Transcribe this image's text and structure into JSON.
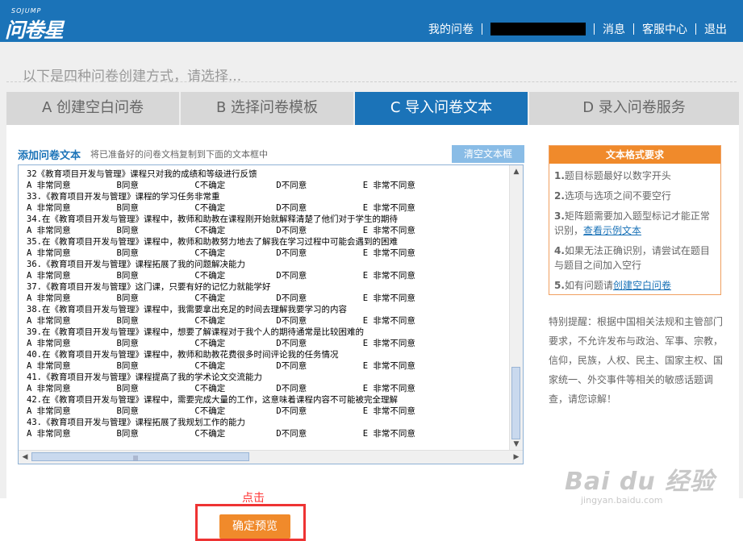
{
  "header": {
    "logo_sub": "SOJUMP",
    "logo_main": "问卷星",
    "nav": [
      "我的问卷",
      "消息",
      "客服中心",
      "退出"
    ]
  },
  "intro": "以下是四种问卷创建方式，请选择...",
  "tabs": [
    {
      "label": "A 创建空白问卷",
      "active": false
    },
    {
      "label": "B 选择问卷模板",
      "active": false
    },
    {
      "label": "C 导入问卷文本",
      "active": true
    },
    {
      "label": "D 录入问卷服务",
      "active": false
    }
  ],
  "editor": {
    "title": "添加问卷文本",
    "hint": "将已准备好的问卷文档复制到下面的文本框中",
    "clear_button": "清空文本框",
    "lines": [
      "32《教育项目开发与管理》课程只对我的成绩和等级进行反馈",
      "A 非常同意         B同意           C不确定          D不同意           E 非常不同意",
      "33.《教育项目开发与管理》课程的学习任务非常重",
      "A 非常同意         B同意           C不确定          D不同意           E 非常不同意",
      "34.在《教育项目开发与管理》课程中，教师和助教在课程刚开始就解释清楚了他们对于学生的期待",
      "A 非常同意         B同意           C不确定          D不同意           E 非常不同意",
      "35.在《教育项目开发与管理》课程中，教师和助教努力地去了解我在学习过程中可能会遇到的困难",
      "A 非常同意         B同意           C不确定          D不同意           E 非常不同意",
      "36.《教育项目开发与管理》课程拓展了我的问题解决能力",
      "A 非常同意         B同意           C不确定          D不同意           E 非常不同意",
      "37.《教育项目开发与管理》这门课，只要有好的记忆力就能学好",
      "A 非常同意         B同意           C不确定          D不同意           E 非常不同意",
      "38.在《教育项目开发与管理》课程中，我需要拿出充足的时间去理解我要学习的内容",
      "A 非常同意         B同意           C不确定          D不同意           E 非常不同意",
      "39.在《教育项目开发与管理》课程中，想要了解课程对于我个人的期待通常是比较困难的",
      "A 非常同意         B同意           C不确定          D不同意           E 非常不同意",
      "40.在《教育项目开发与管理》课程中，教师和助教花费很多时间评论我的任务情况",
      "A 非常同意         B同意           C不确定          D不同意           E 非常不同意",
      "41.《教育项目开发与管理》课程提高了我的学术论文交流能力",
      "A 非常同意         B同意           C不确定          D不同意           E 非常不同意",
      "42.在《教育项目开发与管理》课程中，需要完成大量的工作，这意味着课程内容不可能被完全理解",
      "A 非常同意         B同意           C不确定          D不同意           E 非常不同意",
      "43.《教育项目开发与管理》课程拓展了我规划工作的能力",
      "A 非常同意         B同意           C不确定          D不同意           E 非常不同意"
    ],
    "click_label": "点击",
    "confirm_button": "确定预览"
  },
  "requirements": {
    "title": "文本格式要求",
    "items": [
      {
        "num": "1.",
        "text": "题目标题最好以数字开头"
      },
      {
        "num": "2.",
        "text": "选项与选项之间不要空行"
      },
      {
        "num": "3.",
        "text": "矩阵题需要加入题型标记才能正常识别，",
        "link": "查看示例文本"
      },
      {
        "num": "4.",
        "text": "如果无法正确识别，请尝试在题目与题目之间加入空行"
      },
      {
        "num": "5.",
        "text": "如有问题请",
        "link": "创建空白问卷"
      }
    ],
    "notice": "特别提醒：根据中国相关法规和主管部门要求，不允许发布与政治、军事、宗教，信仰，民族，人权、民主、国家主权、国家统一、外交事件等相关的敏感话题调查，请您谅解！"
  },
  "watermark": {
    "main": "Bai du 经验",
    "sub": "jingyan.baidu.com"
  }
}
